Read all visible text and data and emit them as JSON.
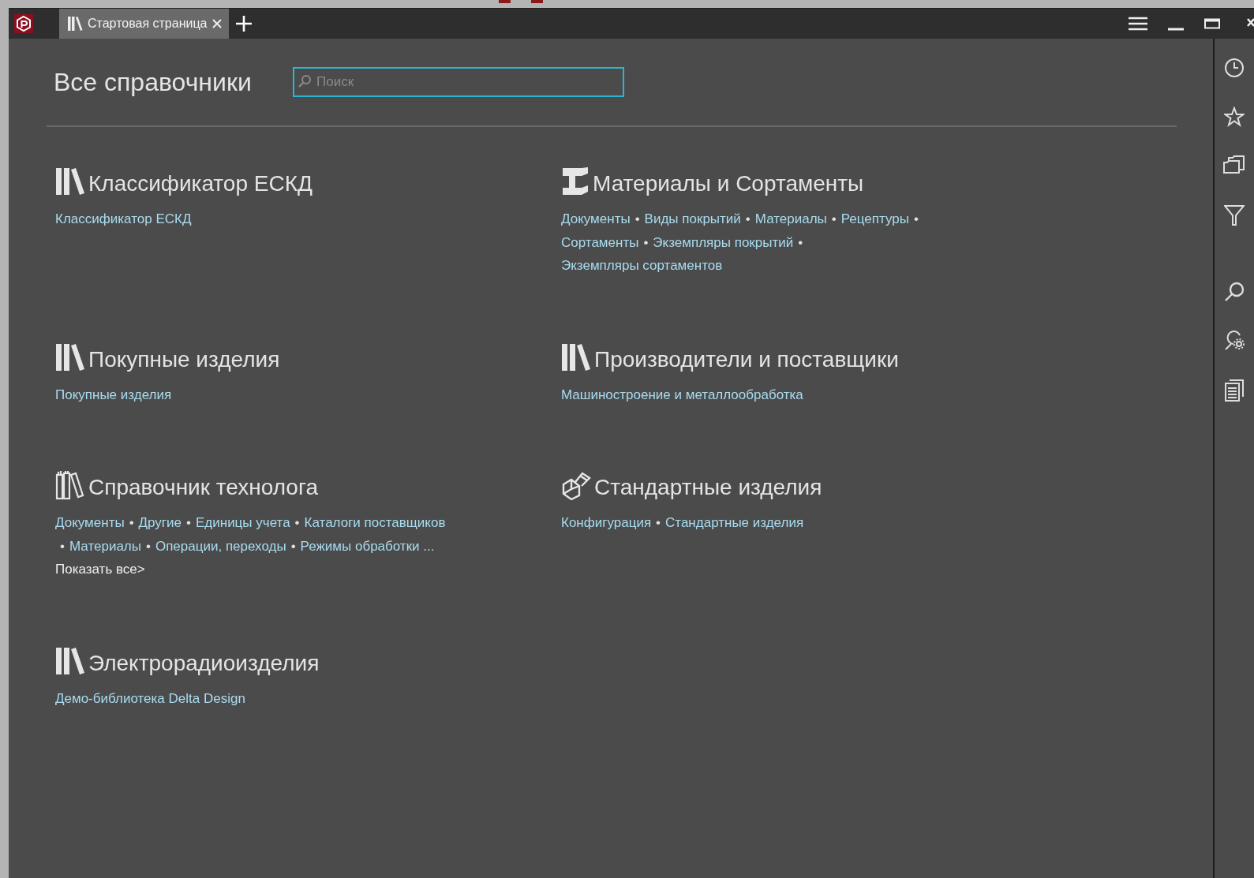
{
  "tabs": [
    {
      "label": "Стартовая страница",
      "selected": true
    }
  ],
  "page_title": "Все справочники",
  "search": {
    "placeholder": "Поиск"
  },
  "separator": "•",
  "catalogs": [
    {
      "kind": "books",
      "title": "Классификатор ЕСКД",
      "links": [
        "Классификатор ЕСКД"
      ]
    },
    {
      "kind": "beam",
      "title": "Материалы и Сортаменты",
      "links": [
        "Документы",
        "Виды покрытий",
        "Материалы",
        "Рецептуры",
        "Сортаменты",
        "Экземпляры покрытий",
        "Экземпляры сортаментов"
      ]
    },
    {
      "kind": "books",
      "title": "Покупные изделия",
      "links": [
        "Покупные изделия"
      ]
    },
    {
      "kind": "books",
      "title": "Производители и поставщики",
      "links": [
        "Машиностроение и металлообработка"
      ]
    },
    {
      "kind": "tech",
      "title": "Справочник технолога",
      "links": [
        "Документы",
        "Другие",
        "Единицы учета",
        "Каталоги поставщиков",
        "Материалы",
        "Операции, переходы",
        "Режимы обработки ..."
      ],
      "show_all": "Показать все>"
    },
    {
      "kind": "bolt",
      "title": "Стандартные изделия",
      "links": [
        "Конфигурация",
        "Стандартные изделия"
      ]
    },
    {
      "kind": "books",
      "title": "Электрорадиоизделия",
      "links": [
        "Демо-библиотека Delta Design"
      ]
    }
  ]
}
